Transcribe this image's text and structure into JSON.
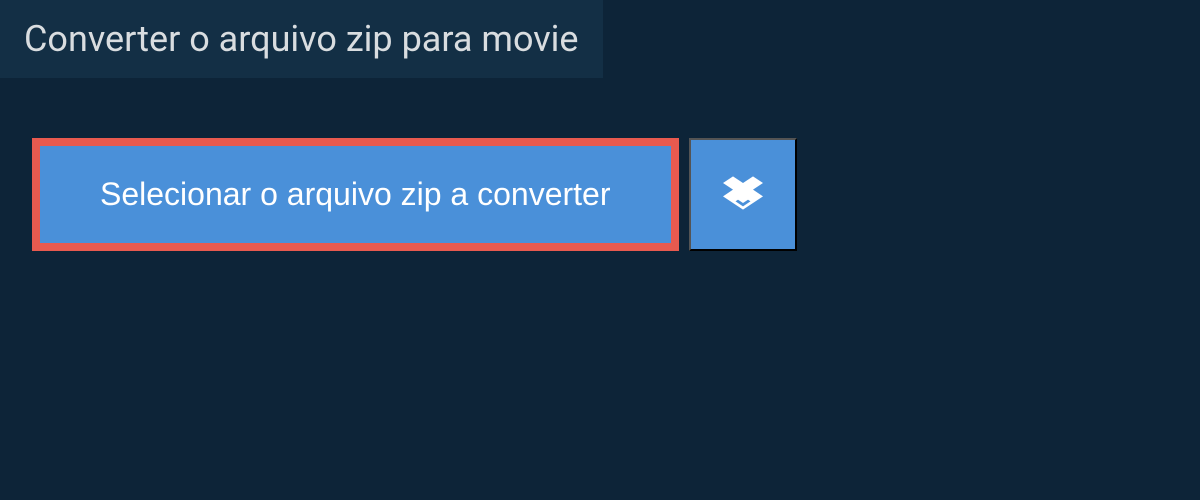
{
  "header": {
    "title": "Converter o arquivo zip para movie"
  },
  "actions": {
    "select_file_label": "Selecionar o arquivo zip a converter"
  },
  "colors": {
    "background": "#0d2438",
    "header_bg": "#132f45",
    "button_bg": "#4a90d9",
    "highlight_border": "#e85a4f",
    "text_light": "#d9dde0",
    "text_white": "#ffffff"
  }
}
